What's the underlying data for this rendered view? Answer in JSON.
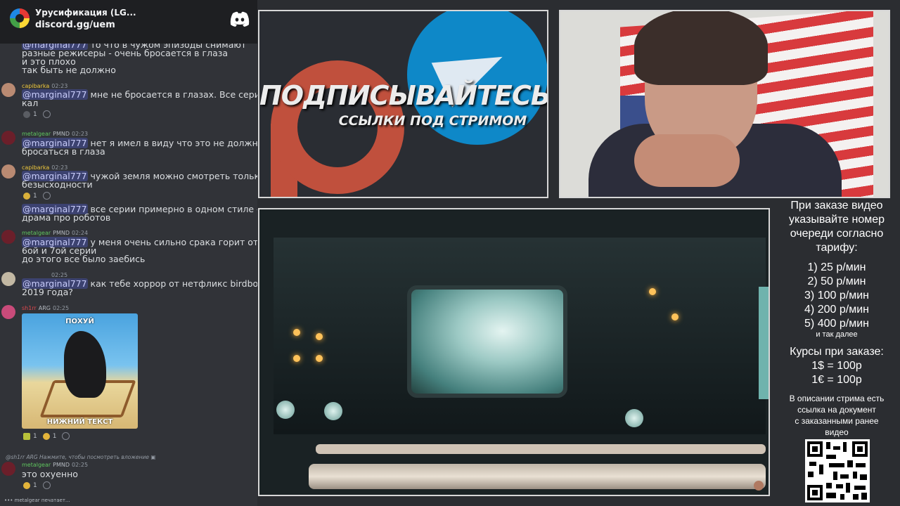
{
  "discord": {
    "server_name": "Урусификация (LG...",
    "invite": "discord.gg/uem",
    "messages": [
      {
        "lines": [
          "то что в чужом эпизоды снимают",
          "разные режисеры - очень бросается в глаза",
          "и это плохо",
          "так быть не должно"
        ],
        "mention_prefix": "@marginal777"
      },
      {
        "user": "capibarka",
        "time": "02:23",
        "mention": "@marginal777",
        "lines": [
          " мне не бросается в глазах. Все серии",
          "кал"
        ],
        "reactions": "1"
      },
      {
        "user": "metalgear",
        "tag": "PMND",
        "time": "02:23",
        "mention": "@marginal777",
        "lines": [
          " нет я имел в виду что это не должно",
          "бросаться в глаза"
        ]
      },
      {
        "user": "capibarka",
        "time": "02:23",
        "mention": "@marginal777",
        "lines": [
          " чужой земля можно смотреть только от",
          "безысходности"
        ],
        "reactions": "1"
      },
      {
        "mention": "@marginal777",
        "lines": [
          " все серии примерно в одном стиле -",
          "драма про роботов"
        ]
      },
      {
        "user": "metalgear",
        "tag": "PMND",
        "time": "02:24",
        "mention": "@marginal777",
        "lines": [
          " у меня очень сильно срака горит от",
          "6ой и 7ой серии",
          "до этого все было заебись"
        ]
      },
      {
        "time": "02:25",
        "mention": "@marginal777",
        "lines": [
          " как тебе хоррор от нетфликс birdbox",
          "2019 года?"
        ]
      },
      {
        "user": "sh1rr",
        "tag": "ARG",
        "time": "02:25",
        "meme_top": "ПОХУЙ",
        "meme_bottom": "НИЖНИЙ ТЕКСТ",
        "reactions": [
          "1",
          "1"
        ]
      },
      {
        "reply_user": "@sh1rr",
        "reply_tag": "ARG",
        "reply_text": "Нажмите, чтобы посмотреть вложение",
        "user": "metalgear",
        "tag": "PMND",
        "time": "02:25",
        "lines": [
          "это охуенно"
        ],
        "reactions": "1"
      }
    ],
    "typing": "metalgear печатает..."
  },
  "promo": {
    "title": "ПОДПИСЫВАЙТЕСЬ",
    "subtitle": "ССЫЛКИ ПОД СТРИМОМ"
  },
  "info": {
    "order_header": [
      "При заказе видео",
      "указывайте номер",
      "очереди согласно",
      "тарифу:"
    ],
    "tariffs": [
      "1) 25 р/мин",
      "2) 50 р/мин",
      "3) 100 р/мин",
      "4) 200 р/мин",
      "5) 400 р/мин"
    ],
    "etc": "и так далее",
    "rates_header": "Курсы при заказе:",
    "rates": [
      "1$ = 100р",
      "1€ = 100р"
    ],
    "description_note": [
      "В описании стрима есть",
      "ссылка на документ",
      "с заказанными ранее",
      "видео"
    ]
  },
  "colors": {
    "accent": "#5865f2",
    "mention_bg": "#3c4270",
    "telegram": "#0e88c8",
    "patreon": "#c0503d"
  }
}
